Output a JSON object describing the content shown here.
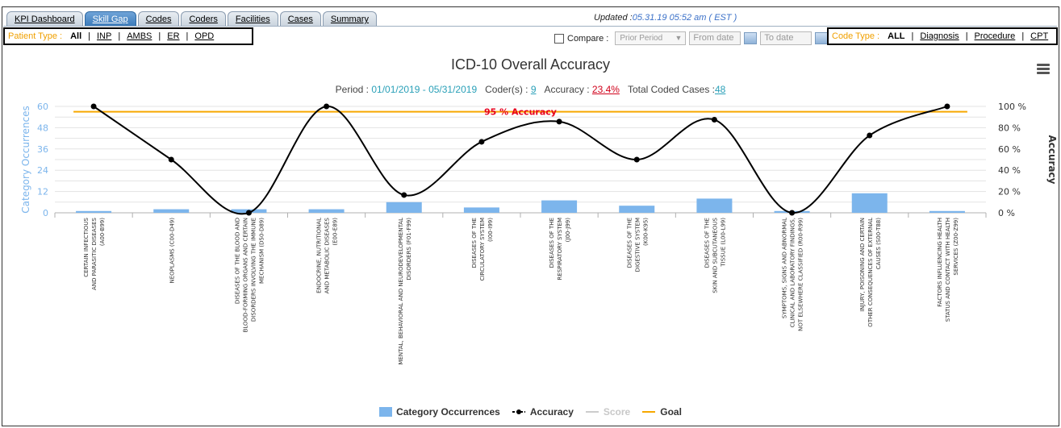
{
  "tabs": [
    {
      "label": "KPI Dashboard",
      "active": false
    },
    {
      "label": "Skill Gap",
      "active": true
    },
    {
      "label": "Codes",
      "active": false
    },
    {
      "label": "Coders",
      "active": false
    },
    {
      "label": "Facilities",
      "active": false
    },
    {
      "label": "Cases",
      "active": false
    },
    {
      "label": "Summary",
      "active": false
    }
  ],
  "updated": {
    "prefix": "Updated :",
    "value": "05.31.19 05:52 am ( EST )"
  },
  "patient_type": {
    "title": "Patient Type :",
    "options": [
      "All",
      "INP",
      "AMBS",
      "ER",
      "OPD"
    ],
    "selected": "All"
  },
  "code_type": {
    "title": "Code Type :",
    "options": [
      "ALL",
      "Diagnosis",
      "Procedure",
      "CPT"
    ],
    "selected": "ALL"
  },
  "compare": {
    "label": "Compare :",
    "period_select": "Prior Period",
    "from_placeholder": "From date",
    "to_placeholder": "To date"
  },
  "summary": {
    "period_label": "Period : ",
    "period_value": "01/01/2019 - 05/31/2019",
    "coders_label": "Coder(s) : ",
    "coders_value": "9",
    "accuracy_label": "Accuracy : ",
    "accuracy_value": "23.4%",
    "cases_label": "Total Coded Cases :",
    "cases_value": "48"
  },
  "colors": {
    "bar": "#7cb5ec",
    "accuracy": "#000000",
    "goal": "#f7a800",
    "goal_label": "#e8001c",
    "left_axis": "#7cb5ec"
  },
  "chart_data": {
    "type": "bar",
    "title": "ICD-10 Overall Accuracy",
    "categories": [
      [
        "CERTAIN INFECTIOUS",
        "AND PARASITIC DISEASES",
        "(A00-B99)"
      ],
      [
        "NEOPLASMS (C00-D49)"
      ],
      [
        "DISEASES OF THE BLOOD AND",
        "BLOOD-FORMING ORGANS AND CERTAIN",
        "DISORDERS INVOLVING THE IMMUNE",
        "MECHANISM (D50-D89)"
      ],
      [
        "ENDOCRINE, NUTRITIONAL",
        "AND METABOLIC DISEASES",
        "(E00-E89)"
      ],
      [
        "MENTAL, BEHAVIORAL AND NEURODEVELOPMENTAL",
        "DISORDERS (F01-F99)"
      ],
      [
        "DISEASES OF THE",
        "CIRCULATORY SYSTEM",
        "(I00-I99)"
      ],
      [
        "DISEASES OF THE",
        "RESPIRATORY SYSTEM",
        "(J00-J99)"
      ],
      [
        "DISEASES OF THE",
        "DIGESTIVE SYSTEM",
        "(K00-K95)"
      ],
      [
        "DISEASES OF THE",
        "SKIN AND SUBCUTANEOUS",
        "TISSUE (L00-L99)"
      ],
      [
        "SYMPTOMS, SIGNS AND ABNORMAL",
        "CLINICAL AND LABORATORY FINDINGS,",
        "NOT ELSEWHERE CLASSIFIED (R00-R99)"
      ],
      [
        "INJURY, POISONING AND CERTAIN",
        "OTHER CONSEQUENCES OF EXTERNAL",
        "CAUSES (S00-T88)"
      ],
      [
        "FACTORS INFLUENCING HEALTH",
        "STATUS AND CONTACT WITH HEALTH",
        "SERVICES (Z00-Z99)"
      ]
    ],
    "series": [
      {
        "name": "Category Occurrences",
        "axis": "left",
        "values": [
          1,
          2,
          2,
          2,
          6,
          3,
          7,
          4,
          8,
          1,
          11,
          1
        ]
      },
      {
        "name": "Accuracy",
        "axis": "right",
        "values": [
          100,
          50,
          0,
          100,
          16.7,
          66.7,
          85.7,
          50,
          87.5,
          0,
          72.7,
          100
        ]
      },
      {
        "name": "Score",
        "axis": "right",
        "values": []
      },
      {
        "name": "Goal",
        "axis": "right",
        "values": [
          95
        ]
      }
    ],
    "goal_label": "95 % Accuracy",
    "y_left": {
      "label": "Category Occurrences",
      "ticks": [
        0,
        12,
        24,
        36,
        48,
        60
      ],
      "range": [
        0,
        60
      ]
    },
    "y_right": {
      "label": "Accuracy",
      "ticks": [
        "0 %",
        "20 %",
        "40 %",
        "60 %",
        "80 %",
        "100 %"
      ],
      "range": [
        0,
        100
      ]
    },
    "grid": true,
    "legend": "bottom-center"
  },
  "legend": {
    "items": [
      {
        "label": "Category Occurrences",
        "dim": false
      },
      {
        "label": "Accuracy",
        "dim": false
      },
      {
        "label": "Score",
        "dim": true
      },
      {
        "label": "Goal",
        "dim": false
      }
    ]
  }
}
